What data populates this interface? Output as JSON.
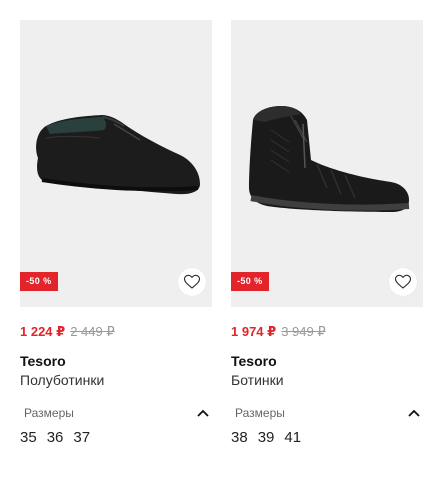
{
  "products": [
    {
      "discount": "-50 %",
      "price_new": "1 224 ₽",
      "price_old": "2 449 ₽",
      "brand": "Tesoro",
      "model": "Полуботинки",
      "sizes_label": "Размеры",
      "sizes": [
        "35",
        "36",
        "37"
      ],
      "image_icon": "loafer-shoe-icon"
    },
    {
      "discount": "-50 %",
      "price_new": "1 974 ₽",
      "price_old": "3 949 ₽",
      "brand": "Tesoro",
      "model": "Ботинки",
      "sizes_label": "Размеры",
      "sizes": [
        "38",
        "39",
        "41"
      ],
      "image_icon": "high-top-boot-icon"
    }
  ],
  "colors": {
    "accent": "#e3242b",
    "photo_bg": "#efefef"
  }
}
